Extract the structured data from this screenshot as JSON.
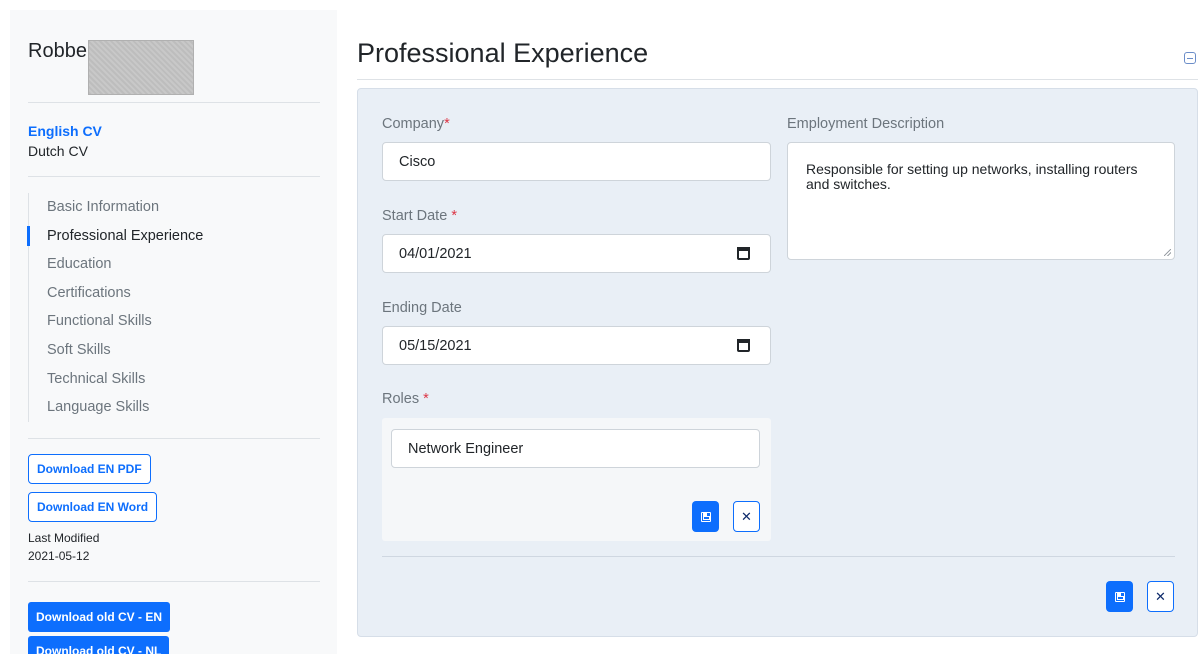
{
  "sidebar": {
    "user_name": "Robbe",
    "cv_languages": [
      {
        "label": "English CV",
        "active": true
      },
      {
        "label": "Dutch CV",
        "active": false
      }
    ],
    "nav": [
      {
        "label": "Basic Information",
        "current": false
      },
      {
        "label": "Professional Experience",
        "current": true
      },
      {
        "label": "Education",
        "current": false
      },
      {
        "label": "Certifications",
        "current": false
      },
      {
        "label": "Functional Skills",
        "current": false
      },
      {
        "label": "Soft Skills",
        "current": false
      },
      {
        "label": "Technical Skills",
        "current": false
      },
      {
        "label": "Language Skills",
        "current": false
      }
    ],
    "download_pdf_label": "Download EN PDF",
    "download_word_label": "Download EN Word",
    "last_modified_label": "Last Modified",
    "last_modified_value": "2021-05-12",
    "download_old_en_label": "Download old CV - EN",
    "download_old_nl_label": "Download old CV - NL"
  },
  "main": {
    "title": "Professional Experience",
    "form": {
      "company_label": "Company",
      "company_value": "Cisco",
      "start_date_label": "Start Date ",
      "start_date_value": "04/01/2021",
      "ending_date_label": "Ending Date",
      "ending_date_value": "05/15/2021",
      "roles_label": "Roles ",
      "role_value": "Network Engineer",
      "required_mark": "*",
      "description_label": "Employment Description",
      "description_value": "Responsible for setting up networks, installing routers and switches."
    }
  },
  "colors": {
    "accent": "#0d6efd",
    "required": "#dc3545",
    "panel_bg": "#e9eff6",
    "sidebar_bg": "#f8f9fa"
  },
  "icons": {
    "save": "floppy-disk-icon",
    "close": "x-icon",
    "calendar": "calendar-icon",
    "collapse": "minus-square-icon"
  }
}
